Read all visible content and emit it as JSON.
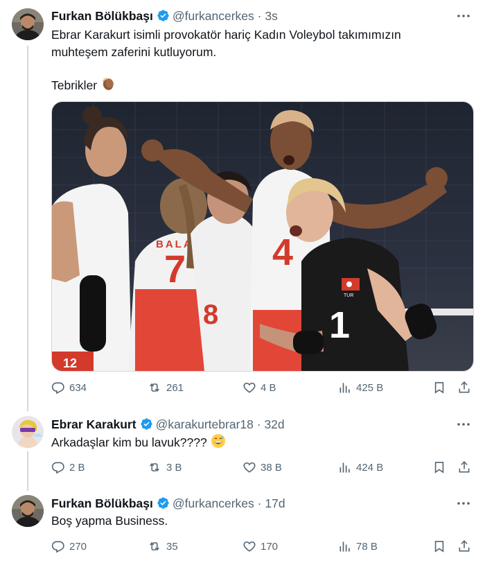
{
  "tweets": [
    {
      "name": "Furkan Bölükbaşı",
      "handle": "@furkancerkes",
      "separator": "·",
      "time": "3s",
      "text_line1": "Ebrar Karakurt isimli provokatör hariç Kadın Voleybol takımımızın",
      "text_line2": "muhteşem zaferini kutluyorum.",
      "text_line3": "Tebrikler",
      "stats": {
        "replies": "634",
        "retweets": "261",
        "likes": "4 B",
        "views": "425 B"
      },
      "media": {
        "jersey_back_name": "BALA",
        "numbers": [
          "7",
          "4",
          "1",
          "8",
          "12"
        ],
        "flag_caption": "TUR"
      }
    },
    {
      "name": "Ebrar Karakurt",
      "handle": "@karakurtebrar18",
      "separator": "·",
      "time": "32d",
      "text_line1": "Arkadaşlar kim bu lavuk????",
      "stats": {
        "replies": "2 B",
        "retweets": "3 B",
        "likes": "38 B",
        "views": "424 B"
      }
    },
    {
      "name": "Furkan Bölükbaşı",
      "handle": "@furkancerkes",
      "separator": "·",
      "time": "17d",
      "text_line1": "Boş yapma Business.",
      "stats": {
        "replies": "270",
        "retweets": "35",
        "likes": "170",
        "views": "78 B"
      }
    }
  ],
  "icons": {
    "verified": "verified-badge-icon",
    "reply": "reply-icon",
    "retweet": "retweet-icon",
    "like": "heart-icon",
    "views": "views-icon",
    "bookmark": "bookmark-icon",
    "share": "share-icon",
    "more": "more-icon"
  },
  "colors": {
    "verified": "#1d9bf0",
    "secondary_text": "#536471",
    "thread_line": "#cfd9de"
  }
}
